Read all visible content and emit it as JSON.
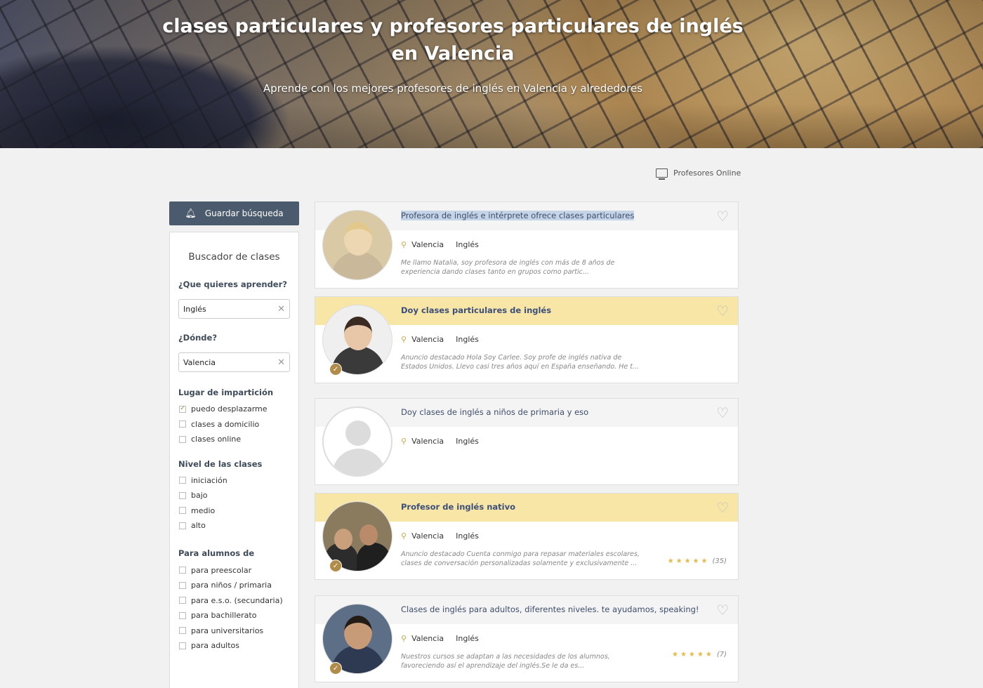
{
  "hero": {
    "title": "clases particulares y profesores particulares de inglés en Valencia",
    "subtitle": "Aprende con los mejores profesores de inglés en Valencia y alrededores"
  },
  "online_link": {
    "label": "Profesores Online",
    "icon": "monitor-icon"
  },
  "save_search": {
    "label": "Guardar búsqueda",
    "icon": "bell-icon"
  },
  "sidebar": {
    "title": "Buscador de clases",
    "what_label": "¿Que quieres aprender?",
    "what_value": "Inglés",
    "where_label": "¿Dónde?",
    "where_value": "Valencia",
    "place_label": "Lugar de impartición",
    "place_options": [
      {
        "label": "puedo desplazarme",
        "checked": true
      },
      {
        "label": "clases a domicilio",
        "checked": false
      },
      {
        "label": "clases online",
        "checked": false
      }
    ],
    "level_label": "Nivel de las clases",
    "level_options": [
      {
        "label": "iniciación",
        "checked": false
      },
      {
        "label": "bajo",
        "checked": false
      },
      {
        "label": "medio",
        "checked": false
      },
      {
        "label": "alto",
        "checked": false
      }
    ],
    "students_label": "Para alumnos de",
    "students_options": [
      {
        "label": "para preescolar",
        "checked": false
      },
      {
        "label": "para niños / primaria",
        "checked": false
      },
      {
        "label": "para e.s.o. (secundaria)",
        "checked": false
      },
      {
        "label": "para bachillerato",
        "checked": false
      },
      {
        "label": "para universitarios",
        "checked": false
      },
      {
        "label": "para adultos",
        "checked": false
      }
    ]
  },
  "cards": [
    {
      "title": "Profesora de inglés e intérprete ofrece clases particulares",
      "featured": false,
      "city": "Valencia",
      "subject": "Inglés",
      "desc": "Me llamo Natalia, soy profesora de inglés con más de 8 años de experiencia dando clases tanto en grupos como partic...",
      "rating": "",
      "reviews": ""
    },
    {
      "title": "Doy clases particulares de inglés",
      "featured": true,
      "city": "Valencia",
      "subject": "Inglés",
      "desc": "Anuncio destacado Hola Soy Carlee. Soy profe de inglés nativa de Estados Unidos. Llevo casi tres años aquí en España enseñando. He t...",
      "rating": "",
      "reviews": ""
    },
    {
      "title": "Doy clases de inglés a niños de primaria y eso",
      "featured": false,
      "city": "Valencia",
      "subject": "Inglés",
      "desc": "",
      "rating": "",
      "reviews": ""
    },
    {
      "title": "Profesor de inglés nativo",
      "featured": true,
      "city": "Valencia",
      "subject": "Inglés",
      "desc": "Anuncio destacado Cuenta conmigo para repasar materiales escolares, clases de conversación personalizadas solamente y exclusivamente ...",
      "rating": "★★★★★",
      "reviews": "(35)"
    },
    {
      "title": "Clases de inglés para adultos, diferentes niveles. te ayudamos, speaking!",
      "featured": false,
      "city": "Valencia",
      "subject": "Inglés",
      "desc": "Nuestros cursos se adaptan a las necesidades de los alumnos, favoreciendo así el aprendizaje del inglés.Se le da es...",
      "rating": "★★★★★",
      "reviews": "(7)"
    }
  ],
  "colors": {
    "header_button": "#4c5a6e",
    "featured_bg": "#f8e6a6",
    "title_blue": "#3e4e6a",
    "star": "#e2bb4a"
  }
}
